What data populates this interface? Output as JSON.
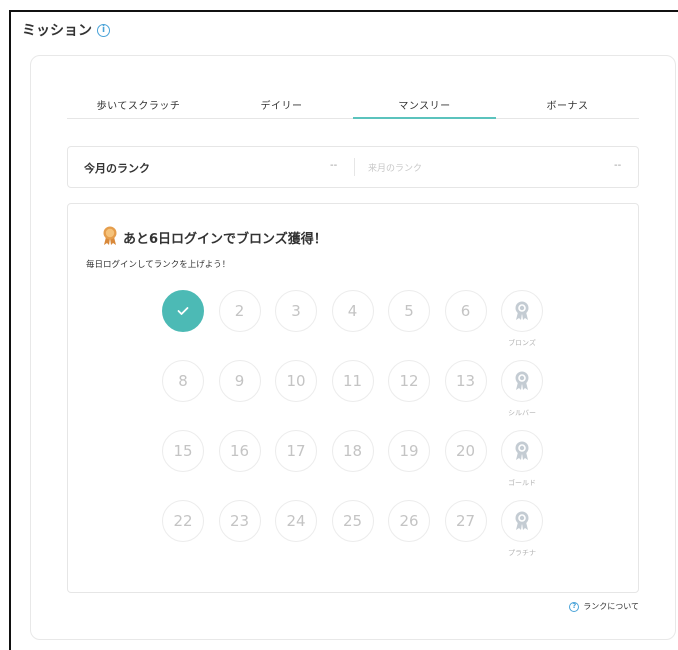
{
  "header": {
    "title": "ミッション",
    "info_icon": "info-icon"
  },
  "tabs": [
    {
      "label": "歩いてスクラッチ",
      "active": false
    },
    {
      "label": "デイリー",
      "active": false
    },
    {
      "label": "マンスリー",
      "active": true
    },
    {
      "label": "ボーナス",
      "active": false
    }
  ],
  "rank": {
    "current_label": "今月のランク",
    "current_value": "--",
    "next_label": "来月のランク",
    "next_value": "--"
  },
  "mission": {
    "title": "あと6日ログインでブロンズ獲得！",
    "subtitle": "毎日ログインしてランクを上げよう！",
    "medal_icon": "bronze-medal-icon",
    "rows": [
      {
        "days": [
          "",
          "2",
          "3",
          "4",
          "5",
          "6"
        ],
        "reward": "ブロンズ"
      },
      {
        "days": [
          "8",
          "9",
          "10",
          "11",
          "12",
          "13"
        ],
        "reward": "シルバー"
      },
      {
        "days": [
          "15",
          "16",
          "17",
          "18",
          "19",
          "20"
        ],
        "reward": "ゴールド"
      },
      {
        "days": [
          "22",
          "23",
          "24",
          "25",
          "26",
          "27"
        ],
        "reward": "プラチナ"
      }
    ],
    "checked_days": [
      "1"
    ]
  },
  "footer": {
    "rank_about": "ランクについて"
  },
  "colors": {
    "accent": "#4cbab5",
    "info": "#4aa3d8"
  }
}
